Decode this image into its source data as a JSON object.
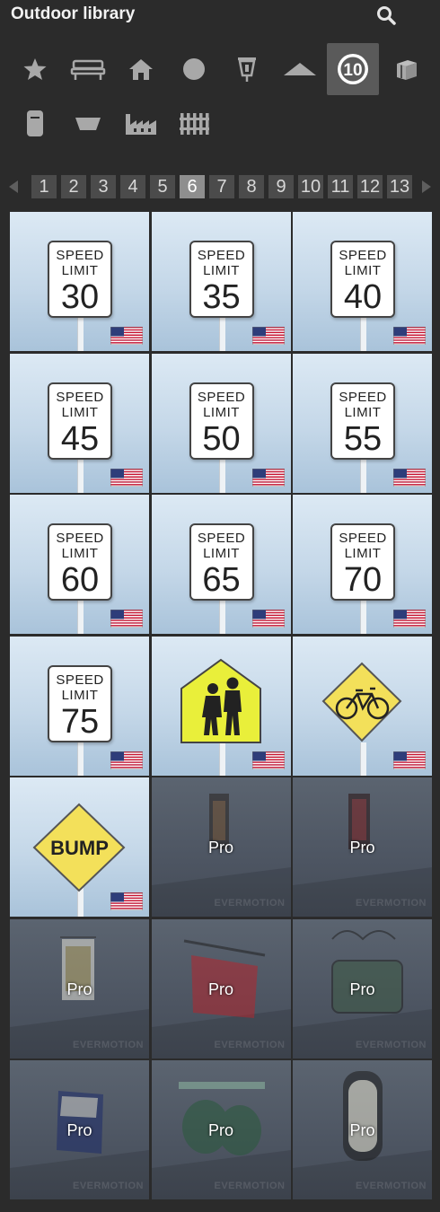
{
  "header": {
    "title": "Outdoor library",
    "search_icon": "search-icon"
  },
  "categories": [
    {
      "icon": "star-icon",
      "active": false
    },
    {
      "icon": "bench-icon",
      "active": false
    },
    {
      "icon": "house-icon",
      "active": false
    },
    {
      "icon": "circle-icon",
      "active": false
    },
    {
      "icon": "lantern-icon",
      "active": false
    },
    {
      "icon": "roof-icon",
      "active": false
    },
    {
      "icon": "number-10-icon",
      "label": "10",
      "active": true
    },
    {
      "icon": "box-icon",
      "active": false
    },
    {
      "icon": "bin-icon",
      "active": false
    },
    {
      "icon": "planter-icon",
      "active": false
    },
    {
      "icon": "factory-icon",
      "active": false
    },
    {
      "icon": "fence-icon",
      "active": false
    }
  ],
  "pager": {
    "prev_icon": "chevron-left-icon",
    "next_icon": "chevron-right-icon",
    "pages": [
      "1",
      "2",
      "3",
      "4",
      "5",
      "6",
      "7",
      "8",
      "9",
      "10",
      "11",
      "12",
      "13"
    ],
    "current": "6"
  },
  "tiles": [
    {
      "kind": "speed",
      "word1": "SPEED",
      "word2": "LIMIT",
      "number": "30",
      "flag": "us-flag-icon"
    },
    {
      "kind": "speed",
      "word1": "SPEED",
      "word2": "LIMIT",
      "number": "35",
      "flag": "us-flag-icon"
    },
    {
      "kind": "speed",
      "word1": "SPEED",
      "word2": "LIMIT",
      "number": "40",
      "flag": "us-flag-icon"
    },
    {
      "kind": "speed",
      "word1": "SPEED",
      "word2": "LIMIT",
      "number": "45",
      "flag": "us-flag-icon"
    },
    {
      "kind": "speed",
      "word1": "SPEED",
      "word2": "LIMIT",
      "number": "50",
      "flag": "us-flag-icon"
    },
    {
      "kind": "speed",
      "word1": "SPEED",
      "word2": "LIMIT",
      "number": "55",
      "flag": "us-flag-icon"
    },
    {
      "kind": "speed",
      "word1": "SPEED",
      "word2": "LIMIT",
      "number": "60",
      "flag": "us-flag-icon"
    },
    {
      "kind": "speed",
      "word1": "SPEED",
      "word2": "LIMIT",
      "number": "65",
      "flag": "us-flag-icon"
    },
    {
      "kind": "speed",
      "word1": "SPEED",
      "word2": "LIMIT",
      "number": "70",
      "flag": "us-flag-icon"
    },
    {
      "kind": "speed",
      "word1": "SPEED",
      "word2": "LIMIT",
      "number": "75",
      "flag": "us-flag-icon"
    },
    {
      "kind": "school",
      "flag": "us-flag-icon"
    },
    {
      "kind": "bike",
      "flag": "us-flag-icon"
    },
    {
      "kind": "bump",
      "text": "BUMP",
      "flag": "us-flag-icon"
    },
    {
      "kind": "pro",
      "label": "Pro",
      "watermark": "EVERMOTION"
    },
    {
      "kind": "pro",
      "label": "Pro",
      "watermark": "EVERMOTION"
    },
    {
      "kind": "pro",
      "label": "Pro",
      "watermark": "EVERMOTION"
    },
    {
      "kind": "pro",
      "label": "Pro",
      "watermark": "EVERMOTION"
    },
    {
      "kind": "pro",
      "label": "Pro",
      "watermark": "EVERMOTION"
    },
    {
      "kind": "pro",
      "label": "Pro",
      "watermark": "EVERMOTION"
    },
    {
      "kind": "pro",
      "label": "Pro",
      "watermark": "EVERMOTION"
    },
    {
      "kind": "pro",
      "label": "Pro",
      "watermark": "EVERMOTION"
    }
  ],
  "colors": {
    "background": "#2b2b2b",
    "active_page": "#8e8e8e",
    "page_bg": "#4b4b4b",
    "sign_yellow": "#f3e05a",
    "school_yellow": "#e9ef3a"
  }
}
